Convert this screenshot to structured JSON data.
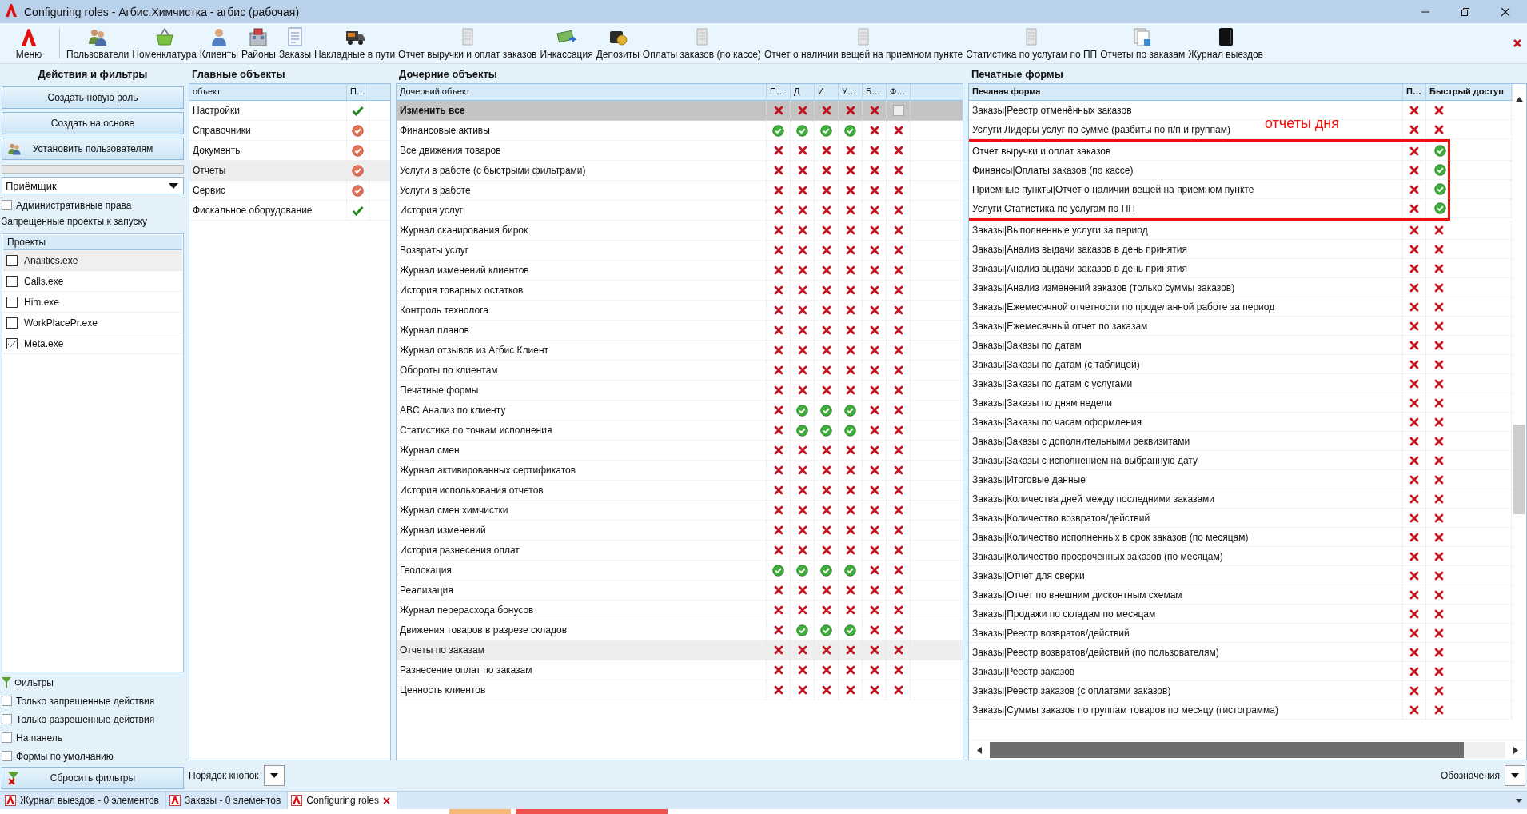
{
  "window": {
    "title": "Configuring roles - Агбис.Химчистка - агбис (рабочая)"
  },
  "toolbar": {
    "menu_label": "Меню",
    "items": [
      {
        "label": "Пользователи",
        "kind": "users"
      },
      {
        "label": "Номенклатура",
        "kind": "basket"
      },
      {
        "label": "Клиенты",
        "kind": "person"
      },
      {
        "label": "Районы",
        "kind": "building"
      },
      {
        "label": "Заказы",
        "kind": "document"
      },
      {
        "label": "Накладные в пути",
        "kind": "truck"
      },
      {
        "label": "Отчет выручки и оплат заказов",
        "kind": "page"
      },
      {
        "label": "Инкассация",
        "kind": "money"
      },
      {
        "label": "Депозиты",
        "kind": "wallet"
      },
      {
        "label": "Оплаты заказов (по кассе)",
        "kind": "page"
      },
      {
        "label": "Отчет о наличии вещей на приемном пункте",
        "kind": "page"
      },
      {
        "label": "Статистика по услугам по ПП",
        "kind": "page"
      },
      {
        "label": "Отчеты по заказам",
        "kind": "papers"
      },
      {
        "label": "Журнал выездов",
        "kind": "book"
      }
    ]
  },
  "actions_panel": {
    "title": "Действия и фильтры",
    "buttons": [
      {
        "label": "Создать новую роль",
        "kind": "plain"
      },
      {
        "label": "Создать на основе",
        "kind": "plain"
      },
      {
        "label": "Установить пользователям",
        "kind": "users"
      }
    ],
    "progress": {
      "level": 0
    },
    "role_select": {
      "value": "Приёмщик"
    },
    "admin_rights": {
      "label": "Административные права",
      "checked": false
    },
    "projects_label": "Запрещенные проекты к запуску",
    "projects": {
      "column": "Проекты",
      "items": [
        {
          "name": "Analitics.exe",
          "checked": false,
          "selected": true
        },
        {
          "name": "Calls.exe",
          "checked": false,
          "selected": false
        },
        {
          "name": "Him.exe",
          "checked": false,
          "selected": false
        },
        {
          "name": "WorkPlacePr.exe",
          "checked": false,
          "selected": false
        },
        {
          "name": "Meta.exe",
          "checked": true,
          "selected": false
        }
      ]
    },
    "filters": {
      "title": "Фильтры",
      "options": [
        {
          "label": "Только запрещенные действия",
          "checked": false
        },
        {
          "label": "Только разрешенные действия",
          "checked": false
        },
        {
          "label": "На панель",
          "checked": false
        },
        {
          "label": "Формы по умолчанию",
          "checked": false
        }
      ],
      "reset_button": "Сбросить фильтры"
    }
  },
  "main_objects": {
    "title": "Главные объекты",
    "columns": [
      "объект",
      "П…"
    ],
    "rows": [
      {
        "name": "Настройки",
        "full_access": true,
        "selected": false
      },
      {
        "name": "Справочники",
        "full_access": false,
        "selected": false
      },
      {
        "name": "Документы",
        "full_access": false,
        "selected": false
      },
      {
        "name": "Отчеты",
        "full_access": false,
        "selected": true
      },
      {
        "name": "Сервис",
        "full_access": false,
        "selected": false
      },
      {
        "name": "Фискальное оборудование",
        "full_access": true,
        "selected": false
      }
    ]
  },
  "child_objects": {
    "title": "Дочерние объекты",
    "columns": [
      "Дочерний объект",
      "П…",
      "Д",
      "И",
      "У…",
      "Б…",
      "Ф…"
    ],
    "rows": [
      {
        "name": "Изменить все",
        "kind": "master",
        "selected": false,
        "cells": [
          false,
          false,
          false,
          false,
          false
        ],
        "last_checked": false
      },
      {
        "name": "Финансовые активы",
        "kind": "item",
        "selected": false,
        "cells": [
          true,
          true,
          true,
          true,
          false,
          false
        ]
      },
      {
        "name": "Все движения товаров",
        "kind": "item",
        "selected": false,
        "cells": [
          false,
          false,
          false,
          false,
          false,
          false
        ]
      },
      {
        "name": "Услуги в работе (с быстрыми фильтрами)",
        "kind": "item",
        "selected": false,
        "cells": [
          false,
          false,
          false,
          false,
          false,
          false
        ]
      },
      {
        "name": "Услуги в работе",
        "kind": "item",
        "selected": false,
        "cells": [
          false,
          false,
          false,
          false,
          false,
          false
        ]
      },
      {
        "name": "История услуг",
        "kind": "item",
        "selected": false,
        "cells": [
          false,
          false,
          false,
          false,
          false,
          false
        ]
      },
      {
        "name": "Журнал сканирования бирок",
        "kind": "item",
        "selected": false,
        "cells": [
          false,
          false,
          false,
          false,
          false,
          false
        ]
      },
      {
        "name": "Возвраты услуг",
        "kind": "item",
        "selected": false,
        "cells": [
          false,
          false,
          false,
          false,
          false,
          false
        ]
      },
      {
        "name": "Журнал изменений клиентов",
        "kind": "item",
        "selected": false,
        "cells": [
          false,
          false,
          false,
          false,
          false,
          false
        ]
      },
      {
        "name": "История товарных остатков",
        "kind": "item",
        "selected": false,
        "cells": [
          false,
          false,
          false,
          false,
          false,
          false
        ]
      },
      {
        "name": "Контроль технолога",
        "kind": "item",
        "selected": false,
        "cells": [
          false,
          false,
          false,
          false,
          false,
          false
        ]
      },
      {
        "name": "Журнал планов",
        "kind": "item",
        "selected": false,
        "cells": [
          false,
          false,
          false,
          false,
          false,
          false
        ]
      },
      {
        "name": "Журнал отзывов из Агбис Клиент",
        "kind": "item",
        "selected": false,
        "cells": [
          false,
          false,
          false,
          false,
          false,
          false
        ]
      },
      {
        "name": "Обороты по клиентам",
        "kind": "item",
        "selected": false,
        "cells": [
          false,
          false,
          false,
          false,
          false,
          false
        ]
      },
      {
        "name": "Печатные формы",
        "kind": "item",
        "selected": false,
        "cells": [
          false,
          false,
          false,
          false,
          false,
          false
        ]
      },
      {
        "name": "ABC Анализ по клиенту",
        "kind": "item",
        "selected": false,
        "cells": [
          false,
          true,
          true,
          true,
          false,
          false
        ]
      },
      {
        "name": "Статистика по точкам исполнения",
        "kind": "item",
        "selected": false,
        "cells": [
          false,
          true,
          true,
          true,
          false,
          false
        ]
      },
      {
        "name": "Журнал смен",
        "kind": "item",
        "selected": false,
        "cells": [
          false,
          false,
          false,
          false,
          false,
          false
        ]
      },
      {
        "name": "Журнал активированных сертификатов",
        "kind": "item",
        "selected": false,
        "cells": [
          false,
          false,
          false,
          false,
          false,
          false
        ]
      },
      {
        "name": "История использования отчетов",
        "kind": "item",
        "selected": false,
        "cells": [
          false,
          false,
          false,
          false,
          false,
          false
        ]
      },
      {
        "name": "Журнал смен химчистки",
        "kind": "item",
        "selected": false,
        "cells": [
          false,
          false,
          false,
          false,
          false,
          false
        ]
      },
      {
        "name": "Журнал изменений",
        "kind": "item",
        "selected": false,
        "cells": [
          false,
          false,
          false,
          false,
          false,
          false
        ]
      },
      {
        "name": "История разнесения оплат",
        "kind": "item",
        "selected": false,
        "cells": [
          false,
          false,
          false,
          false,
          false,
          false
        ]
      },
      {
        "name": "Геолокация",
        "kind": "item",
        "selected": false,
        "cells": [
          true,
          true,
          true,
          true,
          false,
          false
        ]
      },
      {
        "name": "Реализация",
        "kind": "item",
        "selected": false,
        "cells": [
          false,
          false,
          false,
          false,
          false,
          false
        ]
      },
      {
        "name": "Журнал перерасхода бонусов",
        "kind": "item",
        "selected": false,
        "cells": [
          false,
          false,
          false,
          false,
          false,
          false
        ]
      },
      {
        "name": "Движения товаров в разрезе складов",
        "kind": "item",
        "selected": false,
        "cells": [
          false,
          true,
          true,
          true,
          false,
          false
        ]
      },
      {
        "name": "Отчеты по заказам",
        "kind": "item",
        "selected": true,
        "cells": [
          false,
          false,
          false,
          false,
          false,
          false
        ]
      },
      {
        "name": "Разнесение оплат по заказам",
        "kind": "item",
        "selected": false,
        "cells": [
          false,
          false,
          false,
          false,
          false,
          false
        ]
      },
      {
        "name": "Ценность клиентов",
        "kind": "item",
        "selected": false,
        "cells": [
          false,
          false,
          false,
          false,
          false,
          false
        ]
      }
    ]
  },
  "print_forms": {
    "title": "Печатные формы",
    "columns": [
      "Печаная форма",
      "П…",
      "Быстрый доступ"
    ],
    "annotation": "отчеты дня",
    "rows": [
      {
        "name": "Заказы|Реестр отменённых заказов",
        "print": false,
        "quick_access": false,
        "annotated": false
      },
      {
        "name": "Услуги|Лидеры услуг по сумме (разбиты по п/п и группам)",
        "print": false,
        "quick_access": false,
        "annotated": false
      },
      {
        "name": "Отчет выручки и оплат заказов",
        "print": false,
        "quick_access": true,
        "annotated": true
      },
      {
        "name": "Финансы|Оплаты заказов (по кассе)",
        "print": false,
        "quick_access": true,
        "annotated": true
      },
      {
        "name": "Приемные пункты|Отчет о наличии вещей на приемном пункте",
        "print": false,
        "quick_access": true,
        "annotated": true
      },
      {
        "name": "Услуги|Статистика по услугам по ПП",
        "print": false,
        "quick_access": true,
        "annotated": true
      },
      {
        "name": "Заказы|Выполненные услуги за период",
        "print": false,
        "quick_access": false,
        "annotated": false
      },
      {
        "name": "Заказы|Анализ выдачи заказов в день принятия",
        "print": false,
        "quick_access": false,
        "annotated": false
      },
      {
        "name": "Заказы|Анализ выдачи заказов в день принятия",
        "print": false,
        "quick_access": false,
        "annotated": false
      },
      {
        "name": "Заказы|Анализ изменений заказов (только суммы заказов)",
        "print": false,
        "quick_access": false,
        "annotated": false
      },
      {
        "name": "Заказы|Ежемесячной отчетности по проделанной работе за период",
        "print": false,
        "quick_access": false,
        "annotated": false
      },
      {
        "name": "Заказы|Ежемесячный отчет по заказам",
        "print": false,
        "quick_access": false,
        "annotated": false
      },
      {
        "name": "Заказы|Заказы по датам",
        "print": false,
        "quick_access": false,
        "annotated": false
      },
      {
        "name": "Заказы|Заказы по датам (с таблицей)",
        "print": false,
        "quick_access": false,
        "annotated": false
      },
      {
        "name": "Заказы|Заказы по датам с услугами",
        "print": false,
        "quick_access": false,
        "annotated": false
      },
      {
        "name": "Заказы|Заказы по дням недели",
        "print": false,
        "quick_access": false,
        "annotated": false
      },
      {
        "name": "Заказы|Заказы по часам оформления",
        "print": false,
        "quick_access": false,
        "annotated": false
      },
      {
        "name": "Заказы|Заказы с дополнительными реквизитами",
        "print": false,
        "quick_access": false,
        "annotated": false
      },
      {
        "name": "Заказы|Заказы с исполнением на выбранную дату",
        "print": false,
        "quick_access": false,
        "annotated": false
      },
      {
        "name": "Заказы|Итоговые данные",
        "print": false,
        "quick_access": false,
        "annotated": false
      },
      {
        "name": "Заказы|Количества дней между последними заказами",
        "print": false,
        "quick_access": false,
        "annotated": false
      },
      {
        "name": "Заказы|Количество возвратов/действий",
        "print": false,
        "quick_access": false,
        "annotated": false
      },
      {
        "name": "Заказы|Количество исполненных в срок заказов (по месяцам)",
        "print": false,
        "quick_access": false,
        "annotated": false
      },
      {
        "name": "Заказы|Количество просроченных заказов (по месяцам)",
        "print": false,
        "quick_access": false,
        "annotated": false
      },
      {
        "name": "Заказы|Отчет для сверки",
        "print": false,
        "quick_access": false,
        "annotated": false
      },
      {
        "name": "Заказы|Отчет по внешним дисконтным схемам",
        "print": false,
        "quick_access": false,
        "annotated": false
      },
      {
        "name": "Заказы|Продажи по складам по месяцам",
        "print": false,
        "quick_access": false,
        "annotated": false
      },
      {
        "name": "Заказы|Реестр возвратов/действий",
        "print": false,
        "quick_access": false,
        "annotated": false
      },
      {
        "name": "Заказы|Реестр возвратов/действий (по пользователям)",
        "print": false,
        "quick_access": false,
        "annotated": false
      },
      {
        "name": "Заказы|Реестр заказов",
        "print": false,
        "quick_access": false,
        "annotated": false
      },
      {
        "name": "Заказы|Реестр заказов (с оплатами заказов)",
        "print": false,
        "quick_access": false,
        "annotated": false
      },
      {
        "name": "Заказы|Суммы заказов по группам товаров по месяцу (гистограмма)",
        "print": false,
        "quick_access": false,
        "annotated": false
      }
    ]
  },
  "button_order": {
    "label": "Порядок кнопок"
  },
  "legend": {
    "label": "Обозначения"
  },
  "tabs": [
    {
      "label": "Журнал выездов - 0 элементов",
      "selected": false,
      "closable": false
    },
    {
      "label": "Заказы - 0 элементов",
      "selected": false,
      "closable": false
    },
    {
      "label": "Configuring roles",
      "selected": true,
      "closable": true
    }
  ]
}
